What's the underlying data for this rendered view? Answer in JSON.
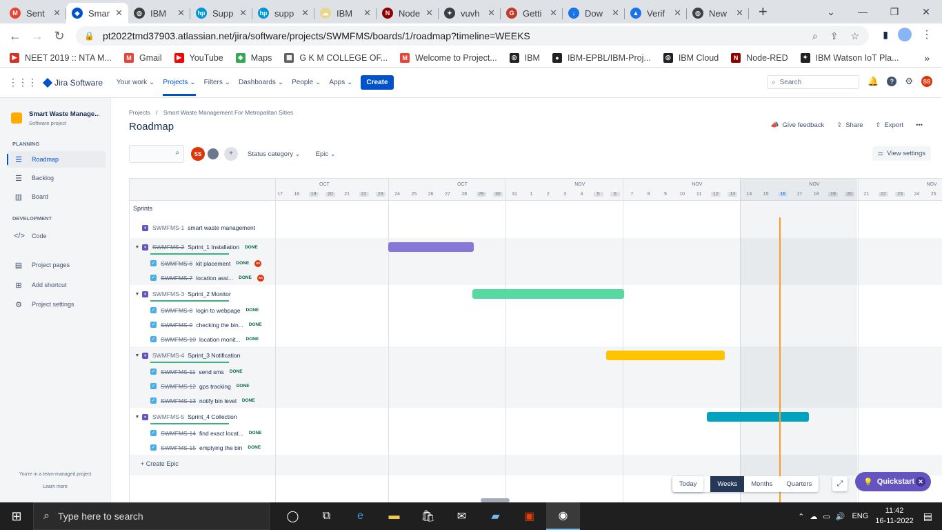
{
  "browser": {
    "tabs": [
      {
        "label": "Sent",
        "color": "#ea4335",
        "glyph": "M"
      },
      {
        "label": "Smar",
        "color": "#0052cc",
        "glyph": "◆",
        "active": true
      },
      {
        "label": "IBM",
        "color": "#3c4043",
        "glyph": "◎"
      },
      {
        "label": "Supp",
        "color": "#0096d6",
        "glyph": "hp"
      },
      {
        "label": "supp",
        "color": "#0096d6",
        "glyph": "hp"
      },
      {
        "label": "IBM",
        "color": "#e8d68a",
        "glyph": "☁"
      },
      {
        "label": "Node",
        "color": "#8f0000",
        "glyph": "N"
      },
      {
        "label": "vuvh",
        "color": "#3c4043",
        "glyph": "✦"
      },
      {
        "label": "Getti",
        "color": "#c0392b",
        "glyph": "G"
      },
      {
        "label": "Dow",
        "color": "#1a73e8",
        "glyph": "↓"
      },
      {
        "label": "Verif",
        "color": "#1a73e8",
        "glyph": "▲"
      },
      {
        "label": "New",
        "color": "#3c4043",
        "glyph": "◎"
      }
    ],
    "url": "pt2022tmd37903.atlassian.net/jira/software/projects/SWMFMS/boards/1/roadmap?timeline=WEEKS",
    "bookmarks": [
      {
        "label": "NEET 2019 :: NTA M...",
        "color": "#d93025",
        "glyph": "▶"
      },
      {
        "label": "Gmail",
        "color": "#ea4335",
        "glyph": "M"
      },
      {
        "label": "YouTube",
        "color": "#ff0000",
        "glyph": "▶"
      },
      {
        "label": "Maps",
        "color": "#34a853",
        "glyph": "◆"
      },
      {
        "label": "G K M COLLEGE OF...",
        "color": "#5f6368",
        "glyph": "▦"
      },
      {
        "label": "Welcome to Project...",
        "color": "#ea4335",
        "glyph": "M"
      },
      {
        "label": "IBM",
        "color": "#202124",
        "glyph": "◎"
      },
      {
        "label": "IBM-EPBL/IBM-Proj...",
        "color": "#202124",
        "glyph": "●"
      },
      {
        "label": "IBM Cloud",
        "color": "#202124",
        "glyph": "◎"
      },
      {
        "label": "Node-RED",
        "color": "#8f0000",
        "glyph": "N"
      },
      {
        "label": "IBM Watson IoT Pla...",
        "color": "#202124",
        "glyph": "✦"
      }
    ]
  },
  "jira": {
    "product": "Jira Software",
    "menu": [
      "Your work",
      "Projects",
      "Filters",
      "Dashboards",
      "People",
      "Apps"
    ],
    "create": "Create",
    "search_placeholder": "Search",
    "user_initials": "SS"
  },
  "sidebar": {
    "project_name": "Smart Waste Manage...",
    "project_type": "Software project",
    "planning_head": "PLANNING",
    "planning": [
      "Roadmap",
      "Backlog",
      "Board"
    ],
    "development_head": "DEVELOPMENT",
    "development": [
      "Code"
    ],
    "other": [
      "Project pages",
      "Add shortcut",
      "Project settings"
    ],
    "footer1": "You're in a team-managed project",
    "footer2": "Learn more"
  },
  "page": {
    "breadcrumb_projects": "Projects",
    "breadcrumb_sep": "/",
    "breadcrumb_project": "Smart Waste Management For Metropalitan Sities",
    "title": "Roadmap",
    "give_feedback": "Give feedback",
    "share": "Share",
    "export": "Export",
    "more": "•••",
    "filter_status": "Status category",
    "filter_epic": "Epic",
    "view_settings": "View settings",
    "sprints_label": "Sprints",
    "create_epic": "Create Epic"
  },
  "timeline": {
    "months": [
      "OCT",
      "OCT",
      "NOV",
      "NOV",
      "NOV",
      "NOV"
    ],
    "days": [
      "17",
      "18",
      "19",
      "20",
      "21",
      "22",
      "23",
      "24",
      "25",
      "26",
      "27",
      "28",
      "29",
      "30",
      "31",
      "1",
      "2",
      "3",
      "4",
      "5",
      "6",
      "7",
      "8",
      "9",
      "10",
      "11",
      "12",
      "13",
      "14",
      "15",
      "16",
      "17",
      "18",
      "19",
      "20",
      "21",
      "22",
      "23",
      "24",
      "25"
    ],
    "weekend_days": [
      "22",
      "23",
      "29",
      "30",
      "5",
      "6",
      "12",
      "13",
      "19",
      "20"
    ],
    "today_day": "16",
    "zoom": {
      "today": "Today",
      "weeks": "Weeks",
      "months": "Months",
      "quarters": "Quarters",
      "selected": "Weeks"
    }
  },
  "rows": [
    {
      "type": "sprint",
      "key": "SWMFMS-1",
      "title": "smart waste management",
      "strike": false,
      "status": ""
    },
    {
      "type": "epic",
      "key": "SWMFMS-2",
      "title": "Sprint_1 Installation",
      "strike": true,
      "status": "DONE",
      "bar_color": "#8777d9",
      "start": "24 Oct",
      "end": "29 Oct"
    },
    {
      "type": "issue",
      "key": "SWMFMS-6",
      "title": "kit placement",
      "status": "DONE",
      "assignee": "SS"
    },
    {
      "type": "issue",
      "key": "SWMFMS-7",
      "title": "location assi...",
      "status": "DONE",
      "assignee": "SS"
    },
    {
      "type": "epic",
      "key": "SWMFMS-3",
      "title": "Sprint_2 Monitor",
      "strike": false,
      "status": "",
      "bar_color": "#57d9a3",
      "start": "29 Oct",
      "end": "7 Nov"
    },
    {
      "type": "issue",
      "key": "SWMFMS-8",
      "title": "login to webpage",
      "status": "DONE"
    },
    {
      "type": "issue",
      "key": "SWMFMS-9",
      "title": "checking the bin...",
      "status": "DONE"
    },
    {
      "type": "issue",
      "key": "SWMFMS-10",
      "title": "location monit...",
      "status": "DONE"
    },
    {
      "type": "epic",
      "key": "SWMFMS-4",
      "title": "Sprint_3 Notification",
      "strike": false,
      "status": "",
      "bar_color": "#ffc400",
      "start": "6 Nov",
      "end": "13 Nov"
    },
    {
      "type": "issue",
      "key": "SWMFMS-11",
      "title": "send sms",
      "status": "DONE"
    },
    {
      "type": "issue",
      "key": "SWMFMS-12",
      "title": "gps tracking",
      "status": "DONE"
    },
    {
      "type": "issue",
      "key": "SWMFMS-13",
      "title": "notify bin level",
      "status": "DONE"
    },
    {
      "type": "epic",
      "key": "SWMFMS-5",
      "title": "Sprint_4 Collection",
      "strike": false,
      "status": "",
      "bar_color": "#00a3bf",
      "start": "12 Nov",
      "end": "18 Nov"
    },
    {
      "type": "issue",
      "key": "SWMFMS-14",
      "title": "find exact locat...",
      "status": "DONE"
    },
    {
      "type": "issue",
      "key": "SWMFMS-15",
      "title": "emptying the bin",
      "status": "DONE"
    }
  ],
  "quickstart": "Quickstart",
  "taskbar": {
    "search_placeholder": "Type here to search",
    "lang": "ENG",
    "time": "11:42",
    "date": "16-11-2022"
  }
}
